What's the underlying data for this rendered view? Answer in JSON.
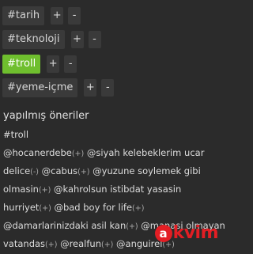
{
  "tags": [
    {
      "label": "#tarih",
      "plus": "+",
      "minus": "-"
    },
    {
      "label": "#teknoloji",
      "plus": "+",
      "minus": "-"
    },
    {
      "label": "#troll",
      "plus": "+",
      "minus": "-"
    },
    {
      "label": "#yeme-içme",
      "plus": "+",
      "minus": "-"
    }
  ],
  "accent_color": "#6fbf2e",
  "suggestions": {
    "title": "yapılmış öneriler",
    "tag": "#troll",
    "lines": [
      [
        {
          "t": "@hocanerdebe",
          "s": "(+)"
        },
        {
          "t": " @siyah kelebeklerim ucar",
          "s": ""
        }
      ],
      [
        {
          "t": "delice",
          "s": "(-)"
        },
        {
          "t": " @cabus",
          "s": "(+)"
        },
        {
          "t": " @yuzune soylemek gibi",
          "s": ""
        }
      ],
      [
        {
          "t": "olmasin",
          "s": "(+)"
        },
        {
          "t": " @kahrolsun istibdat yasasin",
          "s": ""
        }
      ],
      [
        {
          "t": "hurriyet",
          "s": "(+)"
        },
        {
          "t": " @bad boy for life",
          "s": "(+)"
        }
      ],
      [
        {
          "t": "@damarlarinizdaki asil kan",
          "s": "(+)"
        },
        {
          "t": " @manasi olmayan",
          "s": ""
        }
      ],
      [
        {
          "t": "vatandas",
          "s": "(+)"
        },
        {
          "t": " @realfun",
          "s": "(+)"
        },
        {
          "t": " @anguirel",
          "s": "(+)"
        }
      ]
    ]
  },
  "watermark": {
    "badge": "a",
    "text": "kvim"
  }
}
